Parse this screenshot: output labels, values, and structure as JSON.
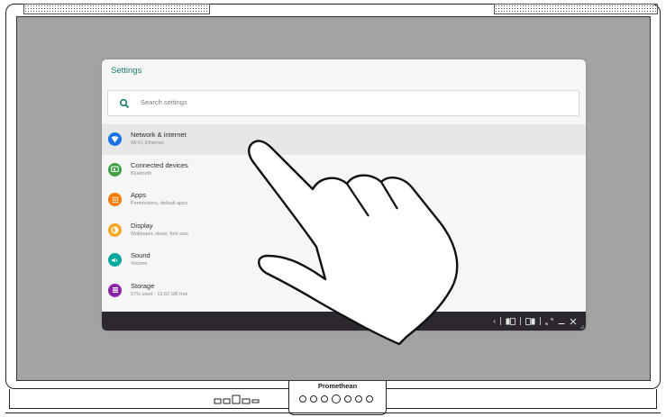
{
  "monitor": {
    "brand": "Promethean"
  },
  "settings": {
    "title": "Settings",
    "search": {
      "placeholder": "Search settings",
      "icon": "search-icon"
    },
    "items": [
      {
        "title": "Network & internet",
        "subtitle": "Wi-Fi, Ethernet",
        "icon": "wifi-icon",
        "color": "#1a73e8",
        "active": true
      },
      {
        "title": "Connected devices",
        "subtitle": "Bluetooth",
        "icon": "devices-icon",
        "color": "#43a047"
      },
      {
        "title": "Apps",
        "subtitle": "Permissions, default apps",
        "icon": "apps-icon",
        "color": "#f57c00"
      },
      {
        "title": "Display",
        "subtitle": "Wallpaper, sleep, font size",
        "icon": "display-icon",
        "color": "#f9a825"
      },
      {
        "title": "Sound",
        "subtitle": "Volume",
        "icon": "sound-icon",
        "color": "#00a99d"
      },
      {
        "title": "Storage",
        "subtitle": "57% used - 13.62 GB free",
        "icon": "storage-icon",
        "color": "#8e24aa"
      }
    ]
  },
  "navbar": {
    "icons": [
      "back-icon",
      "split-left-icon",
      "split-right-icon",
      "fullscreen-icon",
      "minimize-icon",
      "close-icon"
    ]
  },
  "colors": {
    "accent": "#1d7b72",
    "navbar": "#2d2730",
    "screen": "#a3a3a3"
  }
}
